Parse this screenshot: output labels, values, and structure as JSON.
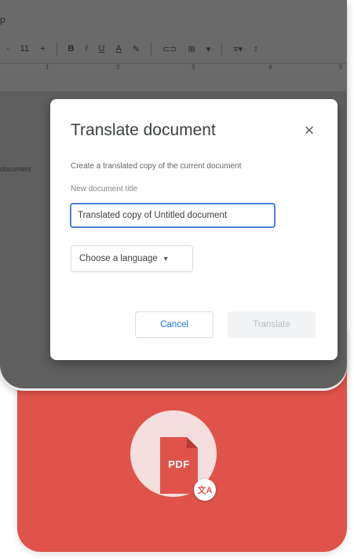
{
  "toolbar": {
    "menu_hint": "p",
    "items": [
      "-",
      "11",
      "+",
      "B",
      "I",
      "U",
      "A",
      "✎",
      "⊂⊃",
      "⊞",
      "▾",
      "≡▾",
      "↕"
    ],
    "ruler_marks": [
      "1",
      "2",
      "3",
      "4",
      "5"
    ]
  },
  "document": {
    "snippet": "document"
  },
  "dialog": {
    "title": "Translate document",
    "close_icon": "×",
    "description": "Create a translated copy of the current document",
    "title_field_label": "New document title",
    "title_field_value": "Translated copy of Untitled document",
    "language_select": "Choose a language",
    "cancel_label": "Cancel",
    "translate_label": "Translate"
  },
  "promo": {
    "file_label": "PDF",
    "badge_glyph": "文A",
    "colors": {
      "card": "#e0534a",
      "circle": "#f4dede"
    }
  }
}
